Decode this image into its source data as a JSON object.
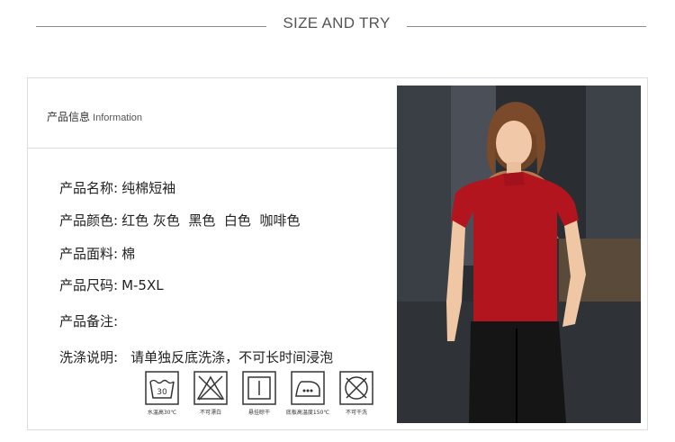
{
  "header": {
    "title": "SIZE AND TRY"
  },
  "info": {
    "tag_cn": "产品信息",
    "tag_en": "Information",
    "rows": [
      {
        "label": "产品名称:",
        "value": "纯棉短袖"
      },
      {
        "label": "产品颜色:",
        "value": "红色 灰色  黑色  白色  咖啡色"
      },
      {
        "label": "产品面料:",
        "value": "棉"
      },
      {
        "label": "产品尺码:",
        "value": "M-5XL"
      },
      {
        "label": "产品备注:",
        "value": ""
      },
      {
        "label": "洗涤说明:",
        "value": "请单独反底洗涤，不可长时间浸泡"
      }
    ]
  },
  "care": [
    {
      "icon": "wash-30-icon",
      "label": "水温高30℃",
      "number": "30"
    },
    {
      "icon": "no-bleach-icon",
      "label": "不可漂白"
    },
    {
      "icon": "hang-dry-icon",
      "label": "悬挂晾干"
    },
    {
      "icon": "iron-icon",
      "label": "底板高温度150℃"
    },
    {
      "icon": "no-dry-clean-icon",
      "label": "不可干洗"
    }
  ],
  "photo": {
    "shirt_color": "#b3151f",
    "pants_color": "#151515"
  }
}
